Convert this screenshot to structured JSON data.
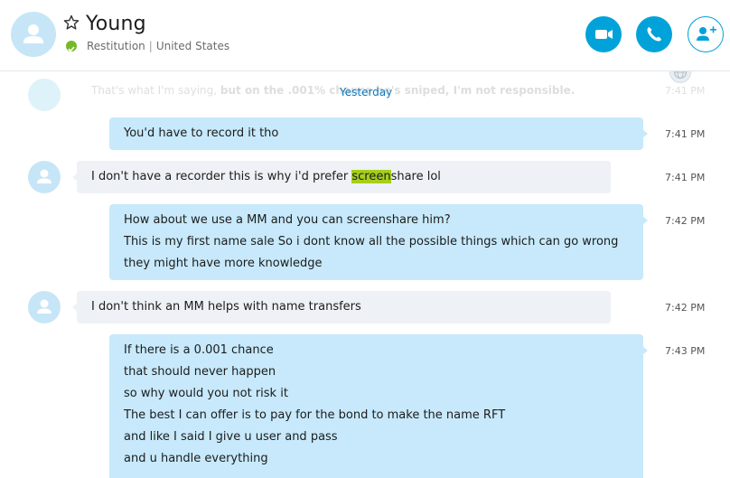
{
  "contact": {
    "name": "Young",
    "status_text": "Restitution",
    "location": "United States",
    "separator": "|"
  },
  "colors": {
    "accent": "#00a2d9",
    "outgoing_bubble": "#c7e9fb",
    "incoming_bubble": "#eef1f5",
    "online": "#76b82a",
    "search_highlight": "#a6cf1a"
  },
  "header_buttons": {
    "video_icon": "video-camera-icon",
    "call_icon": "phone-icon",
    "add_icon": "add-person-icon"
  },
  "ghost_message": {
    "text_a": "That's what I'm saying, ",
    "text_b": "but on the .001% chance he's sniped, I'm not responsible.",
    "time": "7:41 PM"
  },
  "date_divider": "Yesterday",
  "messages": [
    {
      "direction": "out",
      "lines": [
        "You'd have to record it tho"
      ],
      "time": "7:41 PM"
    },
    {
      "direction": "in",
      "pre": "I don't have a recorder this is why i'd prefer ",
      "highlight": "screen",
      "post": "share lol",
      "time": "7:41 PM"
    },
    {
      "direction": "out",
      "lines": [
        "How about we use a MM and you can screenshare him?",
        "This is my first name sale So i dont know all the possible things which can go wrong",
        "they might have more knowledge"
      ],
      "time": "7:42 PM"
    },
    {
      "direction": "in",
      "lines": [
        "I don't think an MM helps with name transfers"
      ],
      "time": "7:42 PM"
    },
    {
      "direction": "out",
      "lines": [
        "If there is a 0.001 chance",
        "that should never happen",
        "so why would you not risk it",
        "The best I can offer is to pay for the bond to make the name RFT",
        "and like I said I give u user and pass",
        "and u handle everything"
      ],
      "time": "7:43 PM"
    }
  ]
}
